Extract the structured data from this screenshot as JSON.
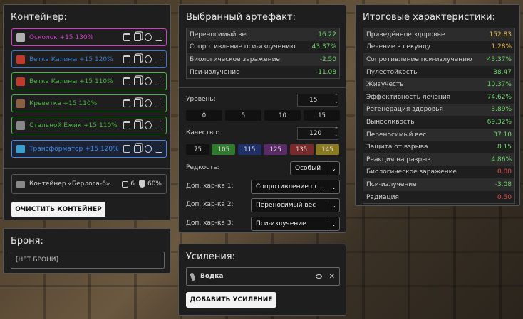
{
  "container": {
    "title": "Контейнер:",
    "items": [
      {
        "name": "Осколок +15 130%",
        "color": "#d13cc9",
        "icon_color": "#b0b0b0"
      },
      {
        "name": "Ветка Калины +15 120%",
        "color": "#3a78d0",
        "icon_color": "#c0392b"
      },
      {
        "name": "Ветка Калины +15 110%",
        "color": "#47b53f",
        "icon_color": "#c0392b"
      },
      {
        "name": "Креветка +15 110%",
        "color": "#47b53f",
        "icon_color": "#8a6040"
      },
      {
        "name": "Стальной Ежик +15 110%",
        "color": "#47b53f",
        "icon_color": "#888"
      },
      {
        "name": "Трансформатор +15 120%",
        "color": "#4a86e8",
        "icon_color": "#3aa0d0"
      }
    ],
    "info": {
      "name": "Контейнер «Берлога-6»",
      "slots": "6",
      "protection": "60%"
    },
    "clear_button": "ОЧИСТИТЬ КОНТЕЙНЕР"
  },
  "armor": {
    "title": "Броня:",
    "value": "[НЕТ БРОНИ]"
  },
  "artifact": {
    "title": "Выбранный артефакт:",
    "stats": [
      {
        "label": "Переносимый вес",
        "value": "16.22",
        "color": "#6fd36a"
      },
      {
        "label": "Сопротивление пси-излучению",
        "value": "43.37%",
        "color": "#6fd36a"
      },
      {
        "label": "Биологическое заражение",
        "value": "-2.50",
        "color": "#6fd36a"
      },
      {
        "label": "Пси-излучение",
        "value": "-11.08",
        "color": "#6fd36a"
      }
    ],
    "level_label": "Уровень:",
    "level_value": "15",
    "level_presets": [
      "0",
      "5",
      "10",
      "15"
    ],
    "quality_label": "Качество:",
    "quality_value": "120",
    "quality_presets": [
      {
        "label": "75",
        "bg": "#111111"
      },
      {
        "label": "105",
        "bg": "#2f7a2f"
      },
      {
        "label": "115",
        "bg": "#1f2f6a"
      },
      {
        "label": "125",
        "bg": "#5a2a66"
      },
      {
        "label": "135",
        "bg": "#7a2a2a"
      },
      {
        "label": "145",
        "bg": "#8a7a20"
      }
    ],
    "rarity_label": "Редкость:",
    "rarity_value": "Особый",
    "extra": [
      {
        "label": "Доп. хар-ка 1:",
        "value": "Сопротивление пс..."
      },
      {
        "label": "Доп. хар-ка 2:",
        "value": "Переносимый вес"
      },
      {
        "label": "Доп. хар-ка 3:",
        "value": "Пси-излучение"
      }
    ]
  },
  "boosts": {
    "title": "Усиления:",
    "item": "Водка",
    "add_button": "ДОБАВИТЬ УСИЛЕНИЕ"
  },
  "totals": {
    "title": "Итоговые характеристики:",
    "stats": [
      {
        "label": "Приведённое здоровье",
        "value": "152.83",
        "color": "#e6b84a"
      },
      {
        "label": "Лечение в секунду",
        "value": "1.28%",
        "color": "#e6b84a"
      },
      {
        "label": "Сопротивление пси-излучению",
        "value": "43.37%",
        "color": "#6fd36a"
      },
      {
        "label": "Пулестойкость",
        "value": "38.47",
        "color": "#6fd36a"
      },
      {
        "label": "Живучесть",
        "value": "10.37%",
        "color": "#6fd36a"
      },
      {
        "label": "Эффективность лечения",
        "value": "74.62%",
        "color": "#6fd36a"
      },
      {
        "label": "Регенерация здоровья",
        "value": "3.89%",
        "color": "#6fd36a"
      },
      {
        "label": "Выносливость",
        "value": "69.32%",
        "color": "#6fd36a"
      },
      {
        "label": "Переносимый вес",
        "value": "37.10",
        "color": "#6fd36a"
      },
      {
        "label": "Защита от взрыва",
        "value": "8.15",
        "color": "#6fd36a"
      },
      {
        "label": "Реакция на разрыв",
        "value": "4.86%",
        "color": "#6fd36a"
      },
      {
        "label": "Биологическое заражение",
        "value": "0.00",
        "color": "#e04848"
      },
      {
        "label": "Пси-излучение",
        "value": "-3.08",
        "color": "#6fd36a"
      },
      {
        "label": "Радиация",
        "value": "0.50",
        "color": "#e04848"
      }
    ]
  }
}
